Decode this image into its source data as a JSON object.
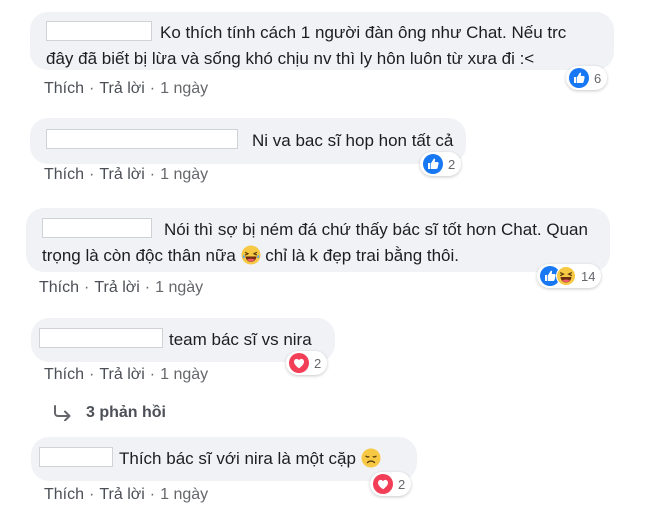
{
  "comments": [
    {
      "text_line1": "Ko thích tính cách 1 người đàn ông như Chat. Nếu trc",
      "text_line2": "đây đã biết bị lừa và sống khó chịu nv thì ly hôn luôn từ xưa đi :<",
      "reaction_count": "6",
      "reaction_icons": [
        "like-icon"
      ],
      "like_label": "Thích",
      "reply_label": "Trả lời",
      "time": "1 ngày"
    },
    {
      "text_line1": "Ni va bac sĩ hop hon tất cả",
      "reaction_count": "2",
      "reaction_icons": [
        "like-icon"
      ],
      "like_label": "Thích",
      "reply_label": "Trả lời",
      "time": "1 ngày"
    },
    {
      "text_line1": "Nói thì sợ bị ném đá chứ thấy bác sĩ tốt hơn Chat. Quan",
      "text_line2a": "trọng là còn độc thân nữa",
      "text_line2b": "chỉ là k đẹp trai bằng thôi.",
      "reaction_count": "14",
      "reaction_icons": [
        "like-icon",
        "haha-icon"
      ],
      "inline_emoji": "laughing-emoji",
      "like_label": "Thích",
      "reply_label": "Trả lời",
      "time": "1 ngày"
    },
    {
      "text_line1": "team bác sĩ vs nira",
      "reaction_count": "2",
      "reaction_icons": [
        "love-icon"
      ],
      "like_label": "Thích",
      "reply_label": "Trả lời",
      "time": "1 ngày"
    },
    {
      "text_line1": "Thích bác sĩ với nira là một cặp",
      "reaction_count": "2",
      "reaction_icons": [
        "love-icon"
      ],
      "inline_emoji": "disappointed-emoji",
      "like_label": "Thích",
      "reply_label": "Trả lời",
      "time": "1 ngày"
    }
  ],
  "replies_link": "3 phản hồi",
  "colors": {
    "bubble": "#f0f2f5",
    "like_blue": "#1877f2",
    "love_red": "#f33e58",
    "muted_text": "#65676b"
  }
}
